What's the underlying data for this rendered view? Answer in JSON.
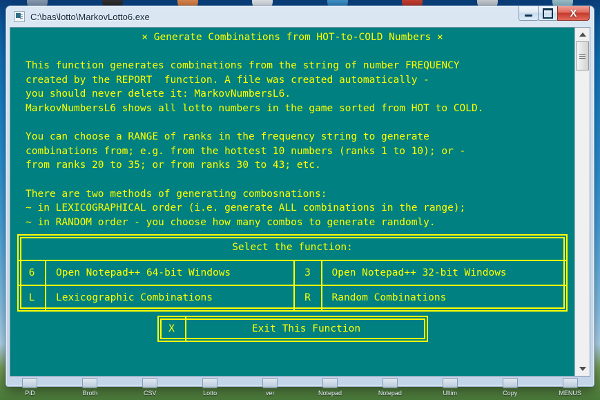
{
  "window": {
    "title": "C:\\bas\\lotto\\MarkovLotto6.exe",
    "icon": "console-icon",
    "buttons": {
      "minimize": "minimize-icon",
      "maximize": "maximize-icon",
      "close": "X"
    },
    "colors": {
      "console_bg": "#008080",
      "console_fg": "#ffff00",
      "close_button": "#c4392b",
      "frame": "#cfdeee"
    }
  },
  "console": {
    "heading": "× Generate Combinations from HOT-to-COLD Numbers ×",
    "paragraphs": [
      [
        "This function generates combinations from the string of number FREQUENCY",
        "created by the REPORT  function. A file was created automatically -",
        "you should never delete it: MarkovNumbersL6.",
        "MarkovNumbersL6 shows all lotto numbers in the game sorted from HOT to COLD."
      ],
      [
        "You can choose a RANGE of ranks in the frequency string to generate",
        "combinations from; e.g. from the hottest 10 numbers (ranks 1 to 10); or -",
        "from ranks 20 to 35; or from ranks 30 to 43; etc."
      ],
      [
        "There are two methods of generating combosnations:",
        "~ in LEXICOGRAPHICAL order (i.e. generate ALL combinations in the range);",
        "~ in RANDOM order - you choose how many combos to generate randomly."
      ]
    ]
  },
  "menu": {
    "title": "Select the function:",
    "rows": [
      {
        "left": {
          "key": "6",
          "label": "Open Notepad++ 64-bit Windows"
        },
        "right": {
          "key": "3",
          "label": "Open Notepad++ 32-bit Windows"
        }
      },
      {
        "left": {
          "key": "L",
          "label": "Lexicographic Combinations"
        },
        "right": {
          "key": "R",
          "label": "Random Combinations"
        }
      }
    ],
    "exit": {
      "key": "X",
      "label": "Exit This Function"
    }
  },
  "scrollbar": {
    "up": "scroll-up-arrow",
    "down": "scroll-down-arrow",
    "thumb_position": "top"
  },
  "desktop": {
    "bottom_icons": [
      {
        "label": "PiD"
      },
      {
        "label": "Broth"
      },
      {
        "label": "CSV"
      },
      {
        "label": "Lotto"
      },
      {
        "label": "ver"
      },
      {
        "label": "Notepad"
      },
      {
        "label": "Notepad"
      },
      {
        "label": "Ultim"
      },
      {
        "label": "Copy"
      },
      {
        "label": "MENUS"
      }
    ]
  }
}
